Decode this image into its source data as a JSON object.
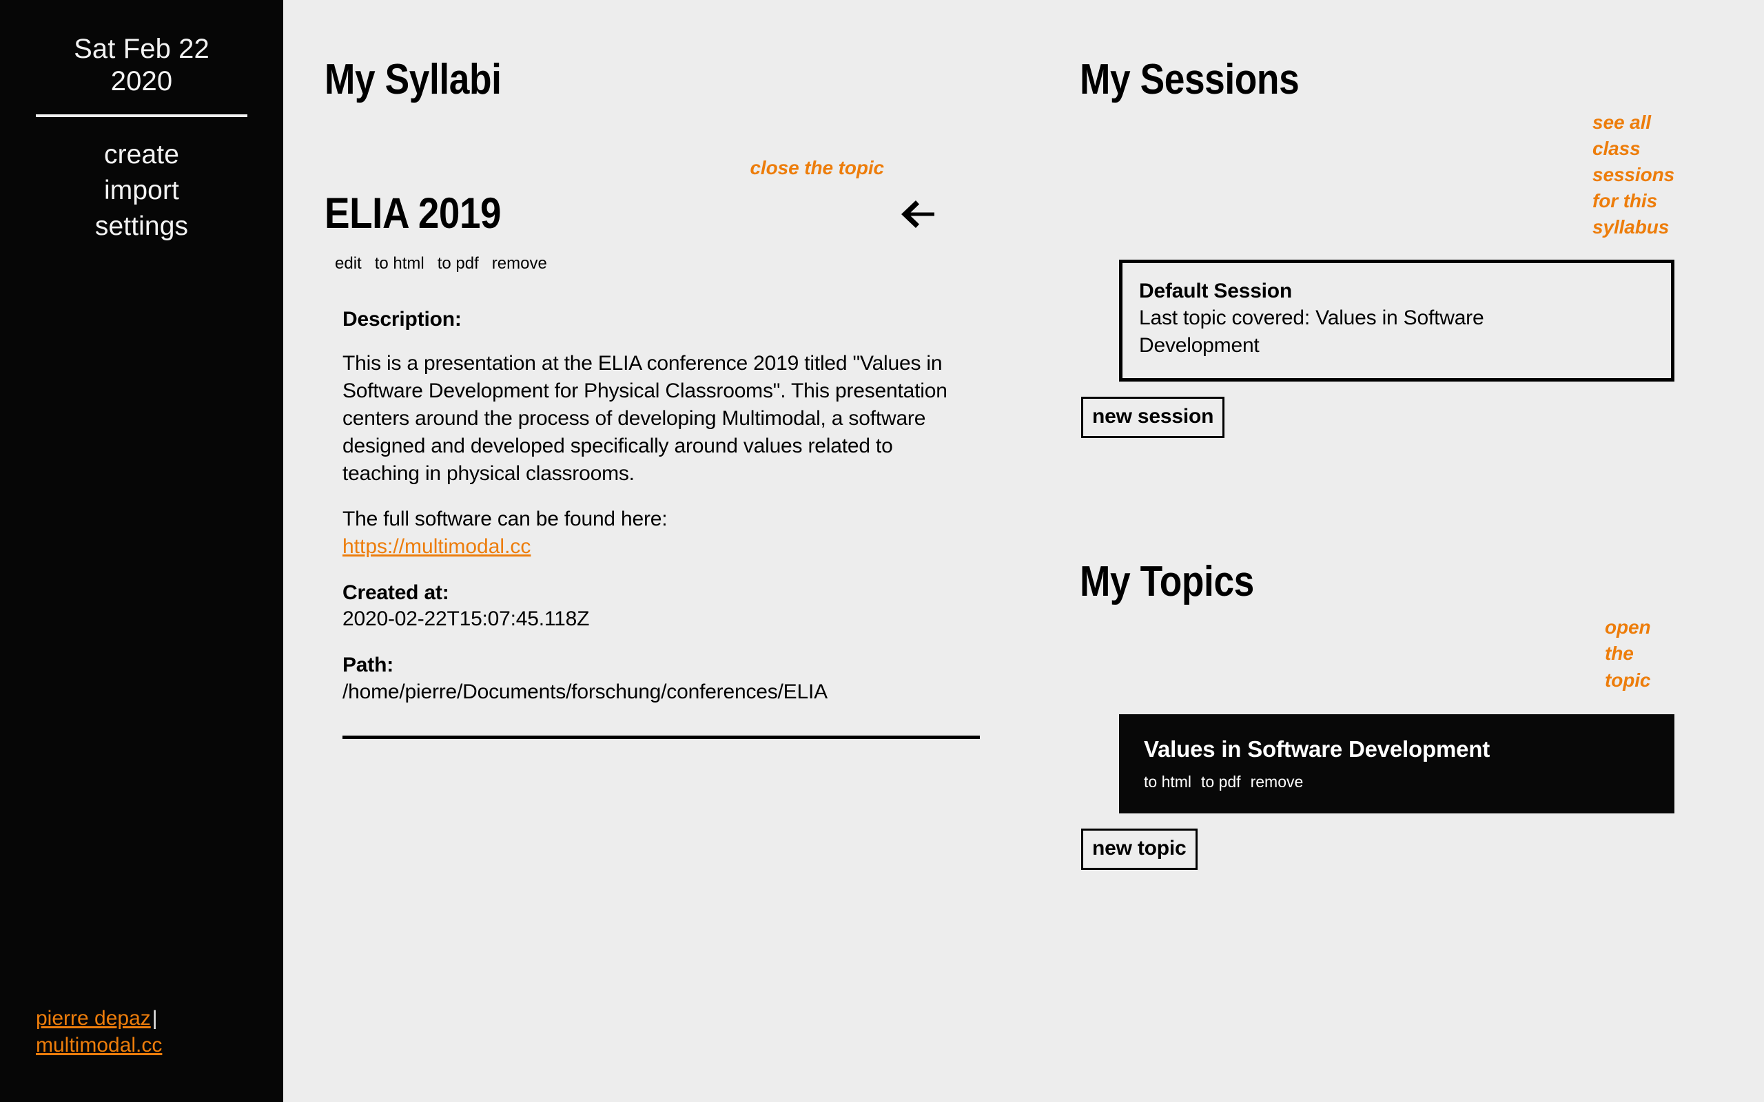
{
  "sidebar": {
    "date": "Sat Feb 22\n2020",
    "nav": [
      {
        "label": "create",
        "name": "create"
      },
      {
        "label": "import",
        "name": "import"
      },
      {
        "label": "settings",
        "name": "settings"
      }
    ],
    "footer": {
      "author_label": "pierre depaz",
      "separator": "|",
      "site_label": "multimodal.cc"
    }
  },
  "syllabi": {
    "section_title": "My Syllabi",
    "close_hint": "close the topic",
    "back_icon": "arrow-left-icon",
    "detail": {
      "title": "ELIA 2019",
      "actions": [
        {
          "label": "edit",
          "name": "edit"
        },
        {
          "label": "to html",
          "name": "to-html"
        },
        {
          "label": "to pdf",
          "name": "to-pdf"
        },
        {
          "label": "remove",
          "name": "remove"
        }
      ],
      "description_label": "Description:",
      "description_body": "This is a presentation at the ELIA conference 2019 titled \"Values in Software Development for Physical Classrooms\". This presentation centers around the process of developing Multimodal, a software designed and developed specifically around values related to teaching in physical classrooms.",
      "link_intro": "The full software can be found here:",
      "link_label": "https://multimodal.cc",
      "created_label": "Created at:",
      "created_value": "2020-02-22T15:07:45.118Z",
      "path_label": "Path:",
      "path_value": "/home/pierre/Documents/forschung/conferences/ELIA"
    }
  },
  "sessions": {
    "section_title": "My Sessions",
    "hint": "see all class sessions\nfor this syllabus",
    "card": {
      "title": "Default Session",
      "subtitle": "Last topic covered: Values in Software Development"
    },
    "new_button": "new session"
  },
  "topics": {
    "section_title": "My Topics",
    "hint": "open the topic",
    "card": {
      "title": "Values in Software Development",
      "actions": [
        {
          "label": "to html",
          "name": "to-html"
        },
        {
          "label": "to pdf",
          "name": "to-pdf"
        },
        {
          "label": "remove",
          "name": "remove"
        }
      ]
    },
    "new_button": "new topic"
  },
  "theme": {
    "accent": "#ED7D0B",
    "sidebar_bg": "#060606",
    "page_bg": "#ededed",
    "ink": "#000000"
  }
}
